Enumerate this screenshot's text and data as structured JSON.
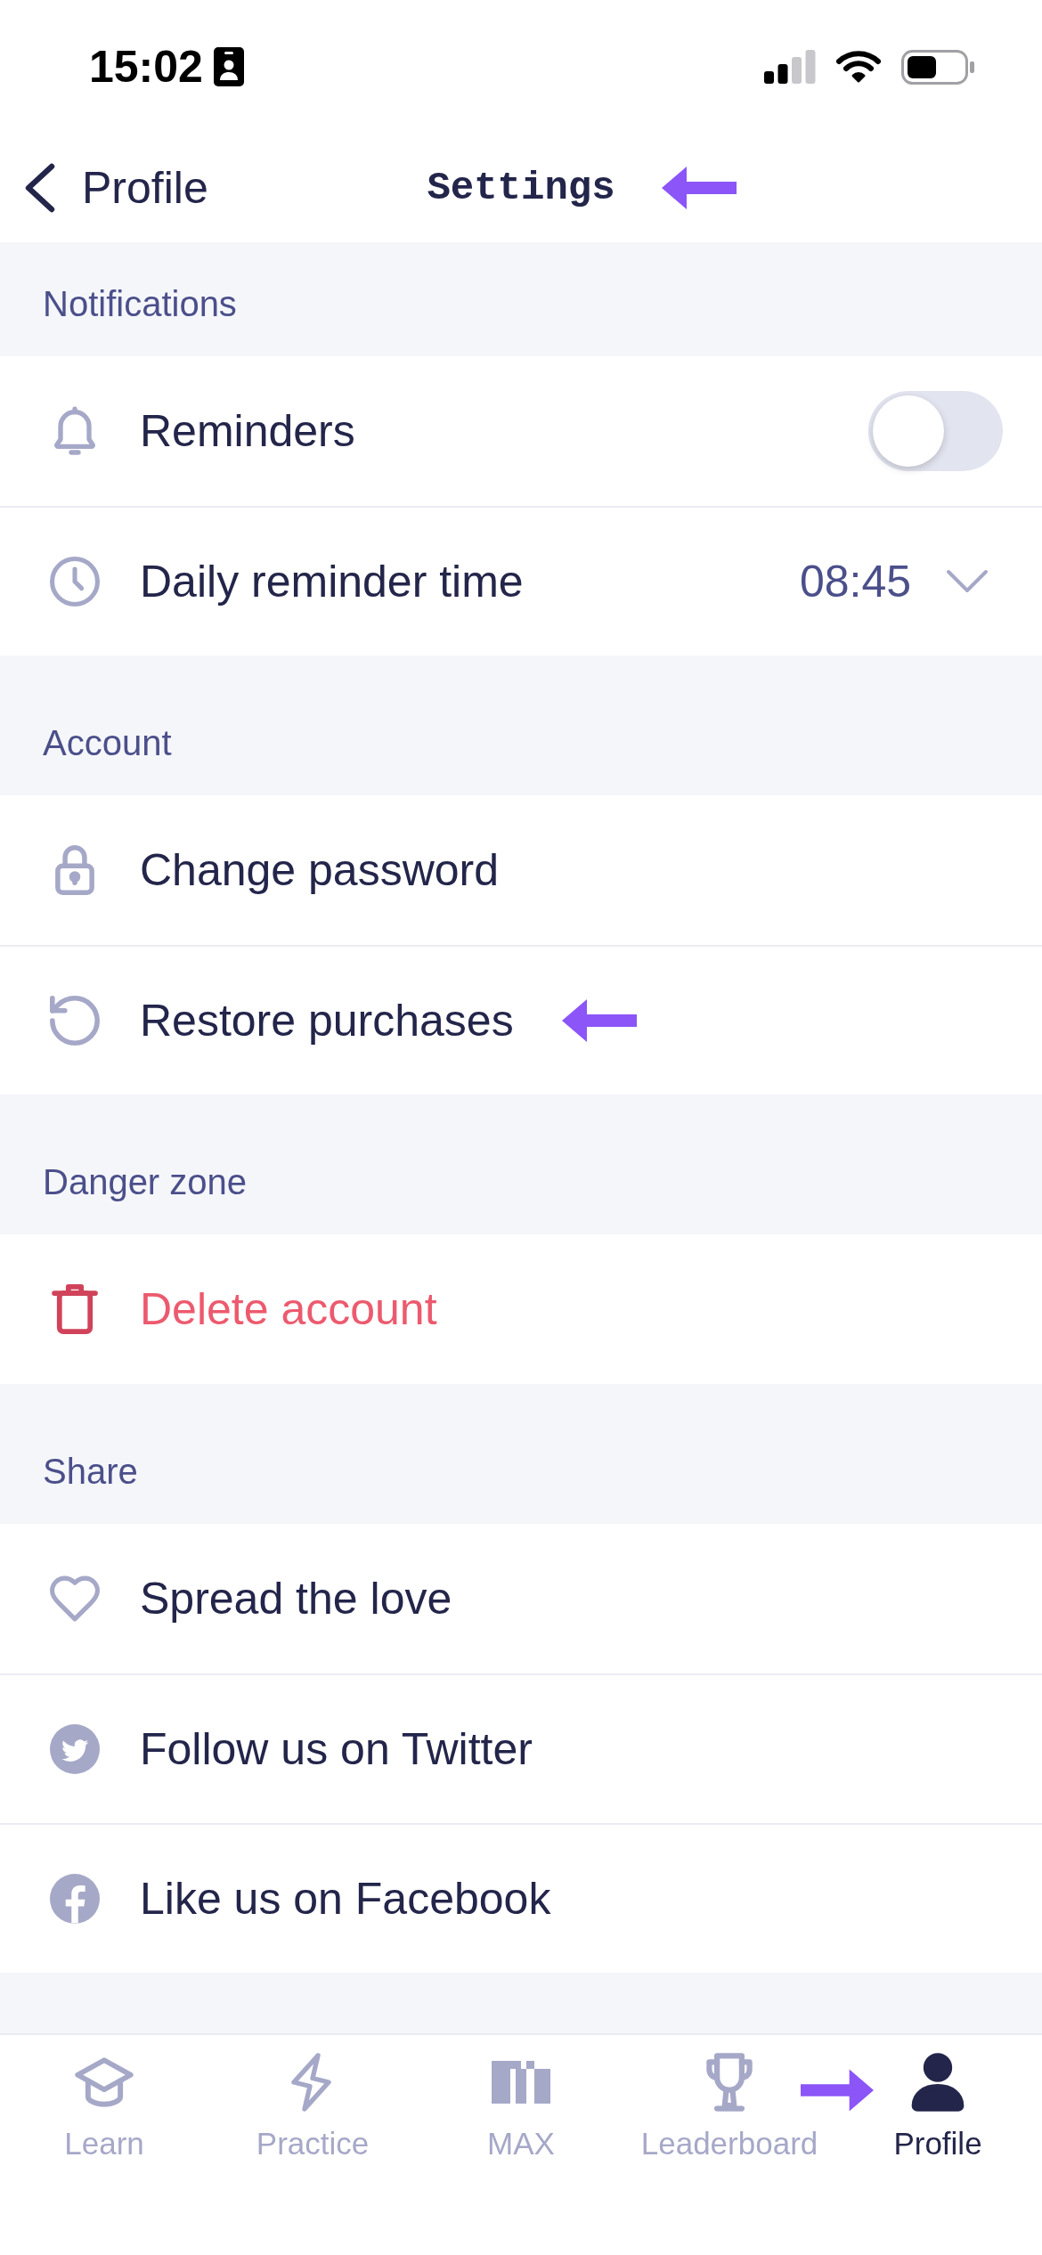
{
  "status_bar": {
    "time": "15:02"
  },
  "nav_bar": {
    "back_label": "Profile",
    "title": "Settings",
    "arrow": true
  },
  "sections": [
    {
      "title": "Notifications",
      "rows": [
        {
          "kind": "toggle",
          "label": "Reminders",
          "on": false,
          "arrow": false
        },
        {
          "kind": "select",
          "label": "Daily reminder time",
          "value": "08:45",
          "arrow": false
        }
      ]
    },
    {
      "title": "Account",
      "rows": [
        {
          "kind": "link",
          "label": "Change password",
          "arrow": false
        },
        {
          "kind": "link",
          "label": "Restore purchases",
          "arrow": true
        }
      ]
    },
    {
      "title": "Danger zone",
      "rows": [
        {
          "kind": "destructive",
          "label": "Delete account",
          "arrow": false
        }
      ]
    },
    {
      "title": "Share",
      "rows": [
        {
          "kind": "link",
          "label": "Spread the love",
          "arrow": false
        },
        {
          "kind": "link",
          "label": "Follow us on Twitter",
          "arrow": false
        },
        {
          "kind": "link",
          "label": "Like us on Facebook",
          "arrow": false
        }
      ]
    }
  ],
  "tab_bar": {
    "tabs": [
      {
        "label": "Learn",
        "selected": false,
        "arrow": false
      },
      {
        "label": "Practice",
        "selected": false,
        "arrow": false
      },
      {
        "label": "MAX",
        "selected": false,
        "arrow": false
      },
      {
        "label": "Leaderboard",
        "selected": false,
        "arrow": false
      },
      {
        "label": "Profile",
        "selected": true,
        "arrow": true
      }
    ]
  }
}
